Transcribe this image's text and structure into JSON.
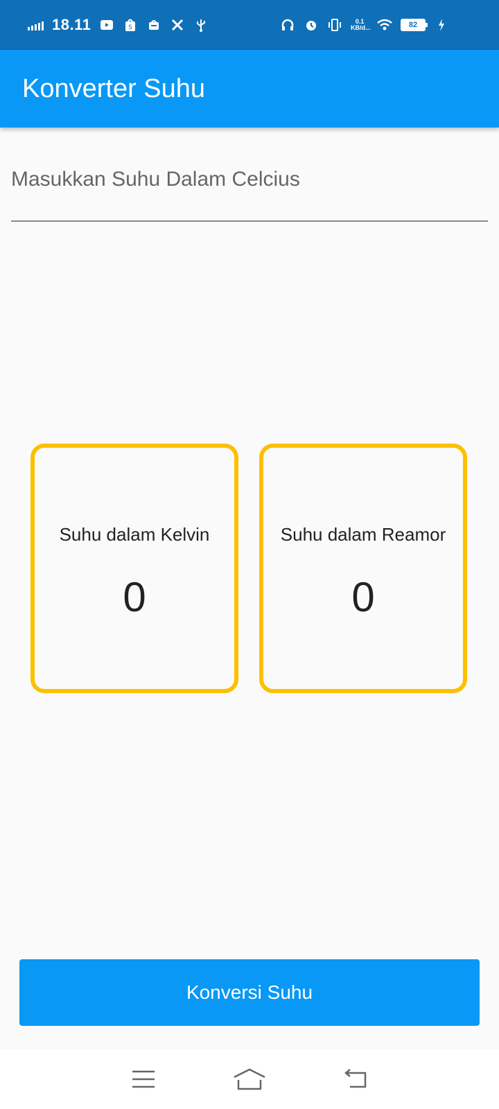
{
  "status_bar": {
    "time": "18.11",
    "net_speed_value": "0.1",
    "net_speed_unit": "KB/d...",
    "battery_level": "82",
    "icons": [
      "signal-icon",
      "youtube-icon",
      "shopee-icon",
      "shop-bag-icon",
      "tools-icon",
      "usb-icon",
      "headphones-icon",
      "alarm-icon",
      "vibrate-icon",
      "wifi-icon",
      "battery-icon",
      "charging-icon"
    ]
  },
  "app_bar": {
    "title": "Konverter Suhu",
    "color": "#0998f5"
  },
  "input": {
    "placeholder": "Masukkan Suhu Dalam Celcius",
    "value": ""
  },
  "results": {
    "kelvin": {
      "label": "Suhu dalam Kelvin",
      "value": "0"
    },
    "reamor": {
      "label": "Suhu dalam Reamor",
      "value": "0"
    },
    "border_color": "#fcc000"
  },
  "button": {
    "label": "Konversi Suhu"
  },
  "nav_bar": {
    "icons": [
      "menu-icon",
      "home-icon",
      "back-icon"
    ]
  }
}
